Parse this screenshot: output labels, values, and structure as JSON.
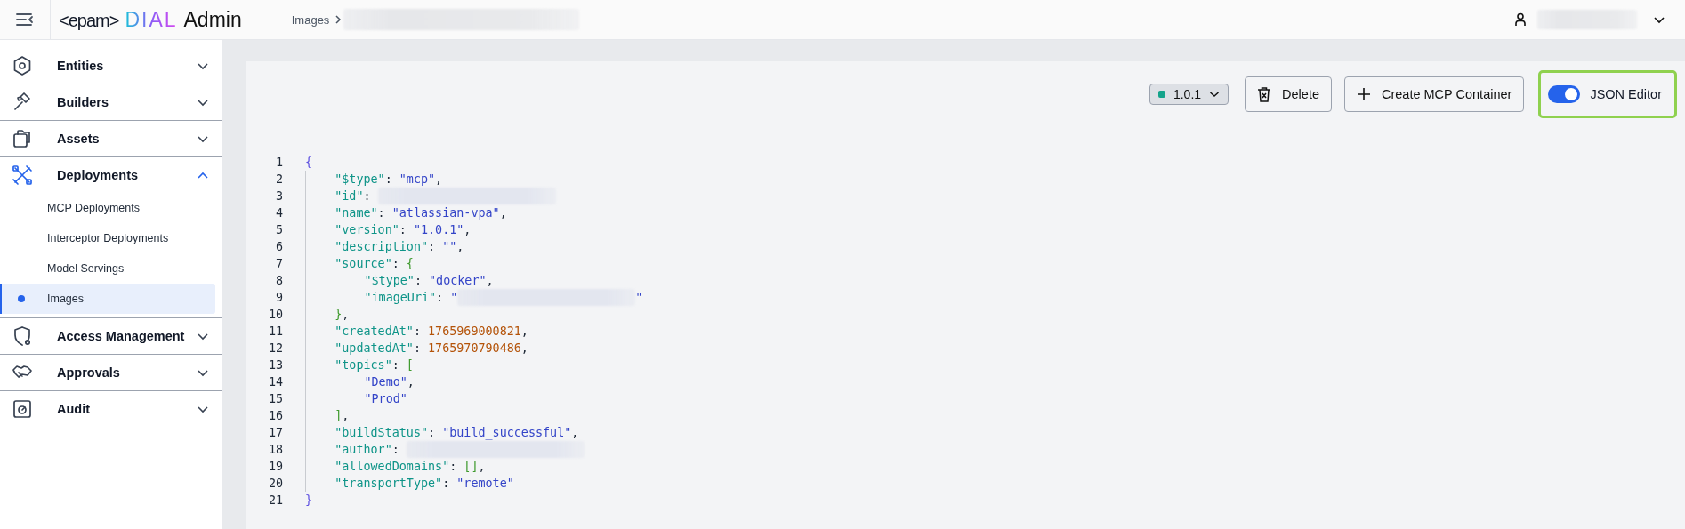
{
  "header": {
    "logo": {
      "brand": "<epam>",
      "product": "DIAL",
      "suffix": "Admin"
    },
    "breadcrumb": "Images"
  },
  "sidebar": {
    "items": [
      {
        "label": "Entities",
        "expanded": false
      },
      {
        "label": "Builders",
        "expanded": false
      },
      {
        "label": "Assets",
        "expanded": false
      },
      {
        "label": "Deployments",
        "expanded": true,
        "children": [
          {
            "label": "MCP Deployments",
            "selected": false
          },
          {
            "label": "Interceptor Deployments",
            "selected": false
          },
          {
            "label": "Model Servings",
            "selected": false
          },
          {
            "label": "Images",
            "selected": true
          }
        ]
      },
      {
        "label": "Access Management",
        "expanded": false
      },
      {
        "label": "Approvals",
        "expanded": false
      },
      {
        "label": "Audit",
        "expanded": false
      }
    ]
  },
  "toolbar": {
    "version": "1.0.1",
    "delete": "Delete",
    "create": "Create MCP Container",
    "editor_toggle": {
      "label": "JSON Editor",
      "on": true
    }
  },
  "code": {
    "lines": [
      {
        "num": "1",
        "tokens": [
          {
            "kind": "brace-outer",
            "text": "{"
          }
        ],
        "children": [
          {
            "num": "2",
            "tokens": [
              {
                "kind": "key",
                "text": "\"$type\""
              },
              {
                "kind": "punct",
                "text": ": "
              },
              {
                "kind": "string",
                "text": "\"mcp\""
              },
              {
                "kind": "punct",
                "text": ","
              }
            ]
          },
          {
            "num": "3",
            "tokens": [
              {
                "kind": "key",
                "text": "\"id\""
              },
              {
                "kind": "punct",
                "text": ": "
              },
              {
                "kind": "redacted"
              }
            ]
          },
          {
            "num": "4",
            "tokens": [
              {
                "kind": "key",
                "text": "\"name\""
              },
              {
                "kind": "punct",
                "text": ": "
              },
              {
                "kind": "string",
                "text": "\"atlassian-vpa\""
              },
              {
                "kind": "punct",
                "text": ","
              }
            ]
          },
          {
            "num": "5",
            "tokens": [
              {
                "kind": "key",
                "text": "\"version\""
              },
              {
                "kind": "punct",
                "text": ": "
              },
              {
                "kind": "string",
                "text": "\"1.0.1\""
              },
              {
                "kind": "punct",
                "text": ","
              }
            ]
          },
          {
            "num": "6",
            "tokens": [
              {
                "kind": "key",
                "text": "\"description\""
              },
              {
                "kind": "punct",
                "text": ": "
              },
              {
                "kind": "string",
                "text": "\"\""
              },
              {
                "kind": "punct",
                "text": ","
              }
            ]
          },
          {
            "num": "7",
            "tokens": [
              {
                "kind": "key",
                "text": "\"source\""
              },
              {
                "kind": "punct",
                "text": ": "
              },
              {
                "kind": "bracket-inner",
                "text": "{"
              }
            ],
            "children": [
              {
                "num": "8",
                "tokens": [
                  {
                    "kind": "key",
                    "text": "\"$type\""
                  },
                  {
                    "kind": "punct",
                    "text": ": "
                  },
                  {
                    "kind": "string",
                    "text": "\"docker\""
                  },
                  {
                    "kind": "punct",
                    "text": ","
                  }
                ]
              },
              {
                "num": "9",
                "tokens": [
                  {
                    "kind": "key",
                    "text": "\"imageUri\""
                  },
                  {
                    "kind": "punct",
                    "text": ": "
                  },
                  {
                    "kind": "string",
                    "text": "\""
                  },
                  {
                    "kind": "redacted"
                  },
                  {
                    "kind": "string",
                    "text": "\""
                  }
                ]
              }
            ]
          },
          {
            "num": "10",
            "tokens": [
              {
                "kind": "bracket-inner",
                "text": "}"
              },
              {
                "kind": "punct",
                "text": ","
              }
            ]
          },
          {
            "num": "11",
            "tokens": [
              {
                "kind": "key",
                "text": "\"createdAt\""
              },
              {
                "kind": "punct",
                "text": ": "
              },
              {
                "kind": "number",
                "text": "1765969000821"
              },
              {
                "kind": "punct",
                "text": ","
              }
            ]
          },
          {
            "num": "12",
            "tokens": [
              {
                "kind": "key",
                "text": "\"updatedAt\""
              },
              {
                "kind": "punct",
                "text": ": "
              },
              {
                "kind": "number",
                "text": "1765970790486"
              },
              {
                "kind": "punct",
                "text": ","
              }
            ]
          },
          {
            "num": "13",
            "tokens": [
              {
                "kind": "key",
                "text": "\"topics\""
              },
              {
                "kind": "punct",
                "text": ": "
              },
              {
                "kind": "bracket-inner",
                "text": "["
              }
            ],
            "children": [
              {
                "num": "14",
                "tokens": [
                  {
                    "kind": "string",
                    "text": "\"Demo\""
                  },
                  {
                    "kind": "punct",
                    "text": ","
                  }
                ]
              },
              {
                "num": "15",
                "tokens": [
                  {
                    "kind": "string",
                    "text": "\"Prod\""
                  }
                ]
              }
            ]
          },
          {
            "num": "16",
            "tokens": [
              {
                "kind": "bracket-inner",
                "text": "]"
              },
              {
                "kind": "punct",
                "text": ","
              }
            ]
          },
          {
            "num": "17",
            "tokens": [
              {
                "kind": "key",
                "text": "\"buildStatus\""
              },
              {
                "kind": "punct",
                "text": ": "
              },
              {
                "kind": "string",
                "text": "\"build_successful\""
              },
              {
                "kind": "punct",
                "text": ","
              }
            ]
          },
          {
            "num": "18",
            "tokens": [
              {
                "kind": "key",
                "text": "\"author\""
              },
              {
                "kind": "punct",
                "text": ": "
              },
              {
                "kind": "redacted"
              }
            ]
          },
          {
            "num": "19",
            "tokens": [
              {
                "kind": "key",
                "text": "\"allowedDomains\""
              },
              {
                "kind": "punct",
                "text": ": "
              },
              {
                "kind": "bracket-inner",
                "text": "[]"
              },
              {
                "kind": "punct",
                "text": ","
              }
            ]
          },
          {
            "num": "20",
            "tokens": [
              {
                "kind": "key",
                "text": "\"transportType\""
              },
              {
                "kind": "punct",
                "text": ": "
              },
              {
                "kind": "string",
                "text": "\"remote\""
              }
            ]
          }
        ]
      },
      {
        "num": "21",
        "tokens": [
          {
            "kind": "brace-outer",
            "text": "}"
          }
        ]
      }
    ]
  }
}
